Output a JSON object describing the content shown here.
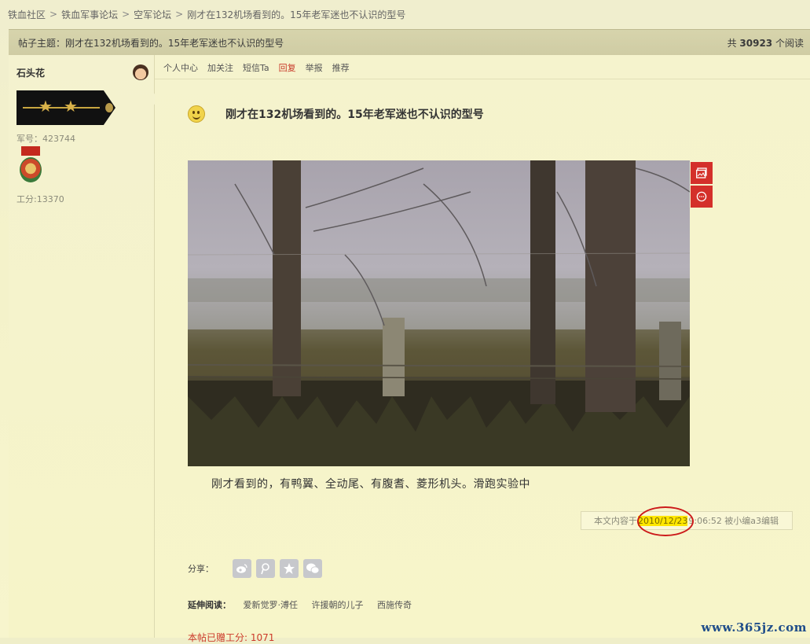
{
  "breadcrumb": [
    "铁血社区",
    "铁血军事论坛",
    "空军论坛",
    "刚才在132机场看到的。15年老军迷也不认识的型号"
  ],
  "breadcrumb_separator": ">",
  "topic_bar": {
    "label": "帖子主题：刚才在132机场看到的。15年老军迷也不认识的型号",
    "right_prefix": "共",
    "view_count": "30923",
    "right_suffix": "个阅读"
  },
  "author": {
    "name": "石头花",
    "soldier_no": "军号：423744",
    "work_points": "工分:13370"
  },
  "actions": [
    "个人中心",
    "加关注",
    "短信Ta",
    "回复",
    "举报",
    "推荐"
  ],
  "post": {
    "title": "刚才在132机场看到的。15年老军迷也不认识的型号",
    "body": "刚才看到的，有鸭翼、全动尾、有腹耆、菱形机头。滑跑实验中"
  },
  "edit_note": {
    "prefix": "本文内容于",
    "date": "2010/12/23",
    "suffix": "9:06:52 被小编a3编辑"
  },
  "share": {
    "label": "分享：",
    "icons": [
      "weibo-icon",
      "tencent-weibo-icon",
      "qzone-star-icon",
      "wechat-icon"
    ]
  },
  "related": {
    "label": "延伸阅读：",
    "items": [
      "爱新觉罗·溥任",
      "许援朝的儿子",
      "西施传奇"
    ]
  },
  "gift_line": "本帖已赠工分: 1071",
  "watermark": "www.365jz.com",
  "colors": {
    "accent_red": "#d4302a",
    "highlight_yellow": "#ffe600",
    "circle_red": "#cc1a1a",
    "title_bar_bg": "#d3d0a8"
  }
}
